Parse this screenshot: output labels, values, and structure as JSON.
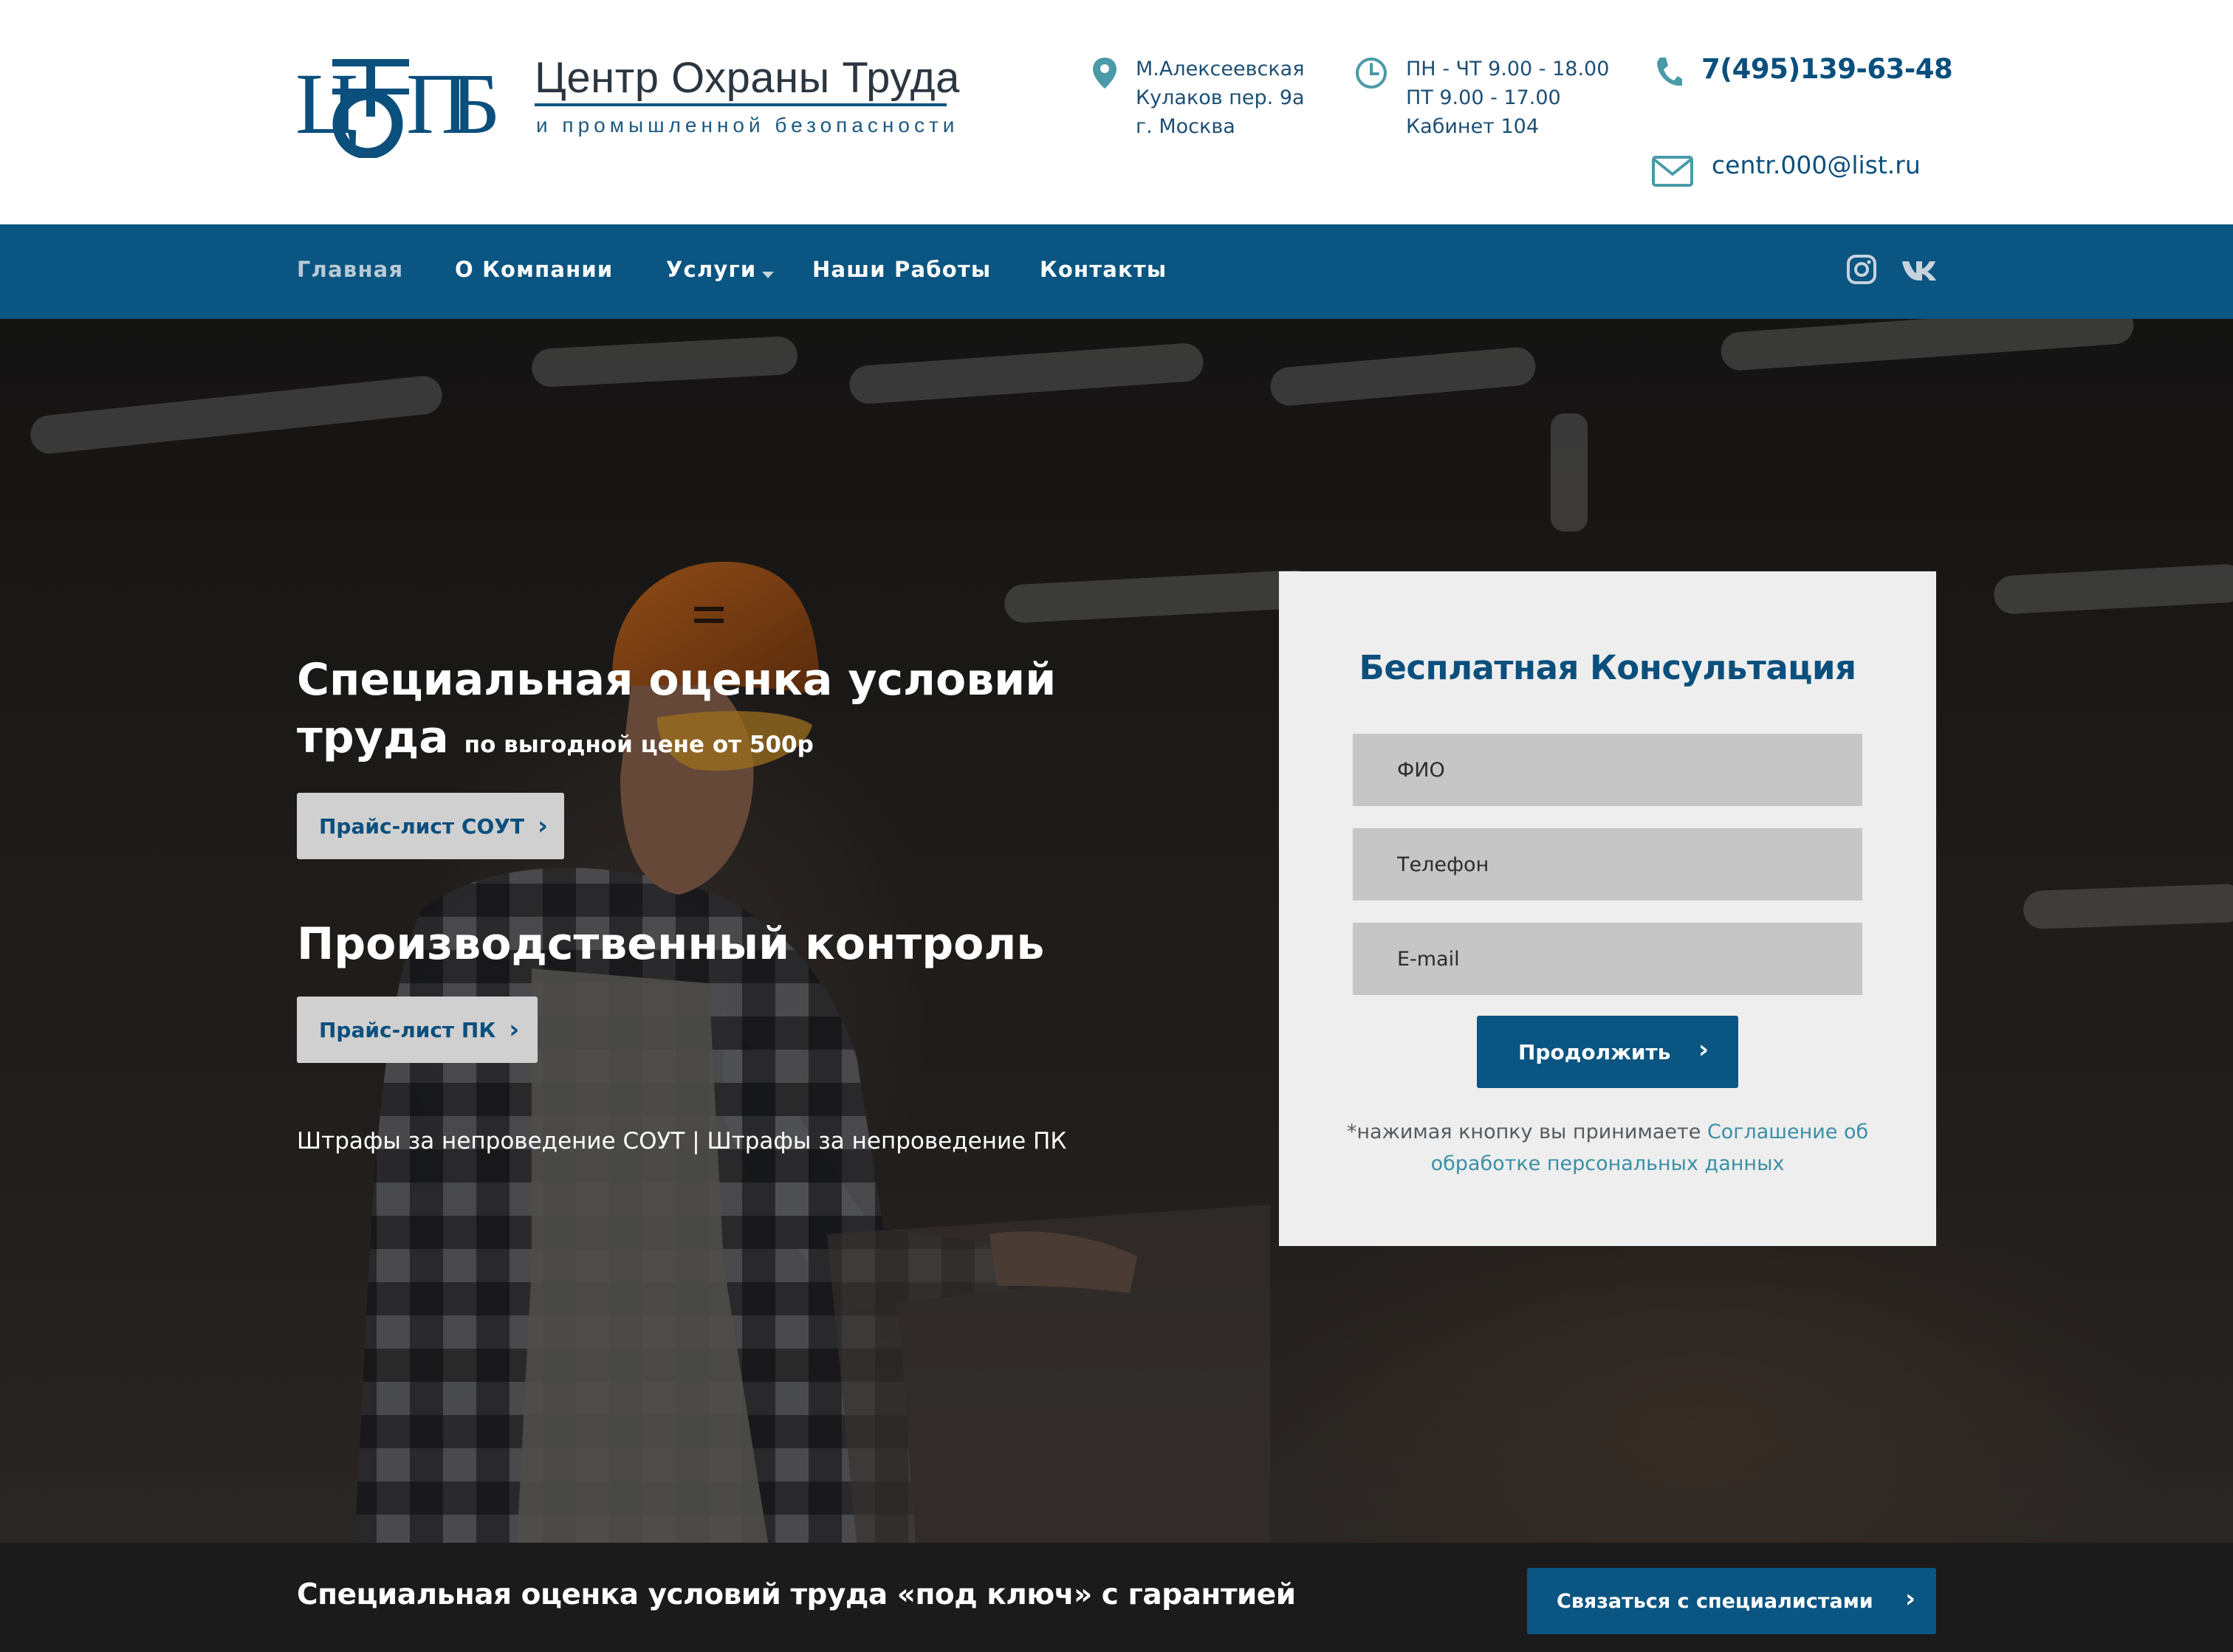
{
  "header": {
    "logo_letters": "ЦОТПБ",
    "logo_title": "Центр Охраны Труда",
    "logo_subtitle": "и промышленной безопасности",
    "address": [
      "М.Алексеевская",
      "Кулаков пер. 9а",
      "г. Москва"
    ],
    "hours": [
      "ПН - ЧТ 9.00 - 18.00",
      "ПТ 9.00 - 17.00",
      "Кабинет 104"
    ],
    "phone": "7(495)139-63-48",
    "email": "centr.000@list.ru",
    "icons": {
      "address": "map-pin-icon",
      "hours": "clock-icon",
      "phone": "phone-icon",
      "email": "mail-icon"
    },
    "accent_color": "#4a9aa8"
  },
  "nav": {
    "items": [
      {
        "label": "Главная",
        "active": true
      },
      {
        "label": "О Компании",
        "active": false
      },
      {
        "label": "Услуги",
        "active": false,
        "has_dropdown": true
      },
      {
        "label": "Наши Работы",
        "active": false
      },
      {
        "label": "Контакты",
        "active": false
      }
    ],
    "social": [
      "instagram-icon",
      "vk-icon"
    ],
    "background": "#0a5581"
  },
  "hero": {
    "sout_title": "Специальная оценка условий труда",
    "sout_price_note": "по выгодной цене от 500р",
    "sout_button": "Прайс-лист СОУТ",
    "pk_title": "Производственный контроль",
    "pk_button": "Прайс-лист ПК",
    "fines_sout": "Штрафы за непроведение СОУТ",
    "fines_separator": "|",
    "fines_pk": "Штрафы за непроведение ПК"
  },
  "form": {
    "title": "Бесплатная Консультация",
    "fields": [
      {
        "placeholder": "ФИО",
        "value": ""
      },
      {
        "placeholder": "Телефон",
        "value": ""
      },
      {
        "placeholder": "E-mail",
        "value": ""
      }
    ],
    "submit": "Продолжить",
    "consent_prefix": "*нажимая кнопку вы принимаете",
    "consent_link": "Соглашение об обработке персональных данных"
  },
  "bottom_bar": {
    "text": "Специальная оценка условий труда «под ключ» с гарантией",
    "button": "Связаться с специалистами"
  }
}
